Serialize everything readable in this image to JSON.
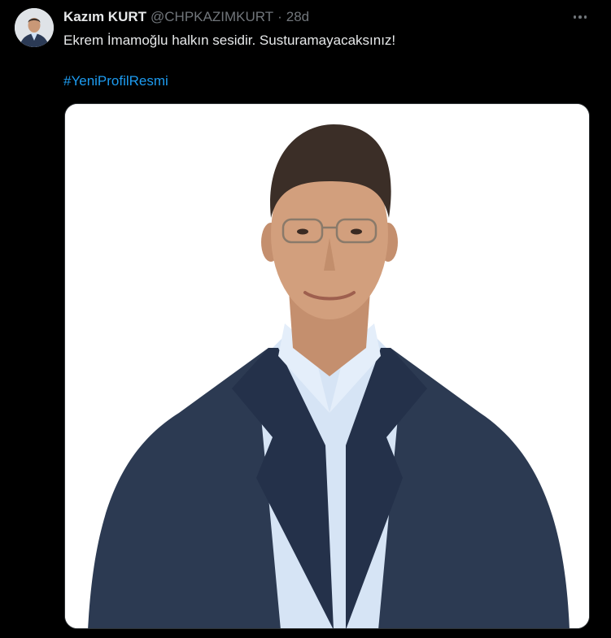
{
  "tweet": {
    "author_name": "Kazım KURT",
    "handle": "@CHPKAZIMKURT",
    "separator": "·",
    "time": "28d",
    "text": "Ekrem İmamoğlu halkın sesidir. Susturamayacaksınız!",
    "hashtag": "#YeniProfilResmi"
  },
  "icons": {
    "more": "more-horizontal-icon",
    "avatar": "profile-avatar"
  },
  "colors": {
    "background": "#000000",
    "text": "#e7e9ea",
    "secondary": "#71767b",
    "link": "#1d9bf0",
    "media_background": "#ffffff"
  }
}
